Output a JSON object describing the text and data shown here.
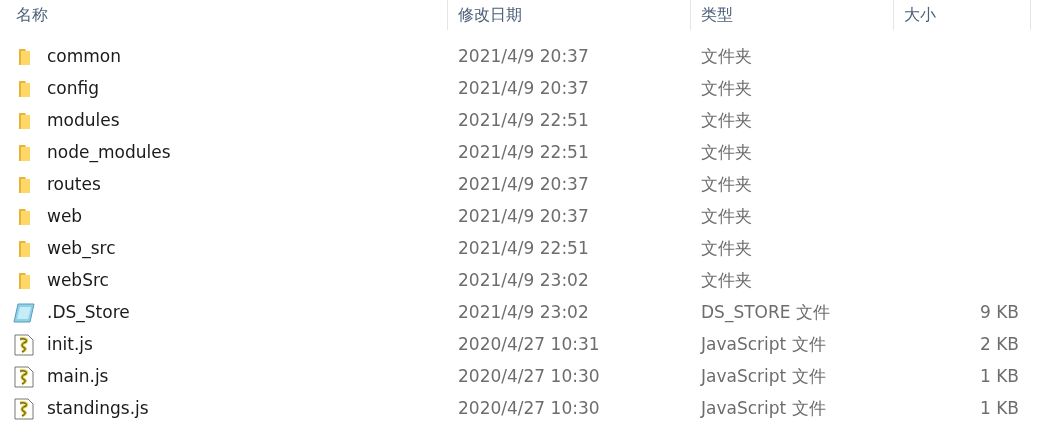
{
  "columns": [
    "名称",
    "修改日期",
    "类型",
    "大小"
  ],
  "files": [
    {
      "kind": "folder",
      "name": "common",
      "date": "2021/4/9 20:37",
      "type": "文件夹"
    },
    {
      "kind": "folder",
      "name": "config",
      "date": "2021/4/9 20:37",
      "type": "文件夹"
    },
    {
      "kind": "folder",
      "name": "modules",
      "date": "2021/4/9 22:51",
      "type": "文件夹"
    },
    {
      "kind": "folder",
      "name": "node_modules",
      "date": "2021/4/9 22:51",
      "type": "文件夹"
    },
    {
      "kind": "folder",
      "name": "routes",
      "date": "2021/4/9 20:37",
      "type": "文件夹"
    },
    {
      "kind": "folder",
      "name": "web",
      "date": "2021/4/9 20:37",
      "type": "文件夹"
    },
    {
      "kind": "folder",
      "name": "web_src",
      "date": "2021/4/9 22:51",
      "type": "文件夹"
    },
    {
      "kind": "folder",
      "name": "webSrc",
      "date": "2021/4/9 23:02",
      "type": "文件夹"
    },
    {
      "kind": "notepad",
      "name": ".DS_Store",
      "date": "2021/4/9 23:02",
      "type": "DS_STORE 文件",
      "size": "9 KB"
    },
    {
      "kind": "script",
      "name": "init.js",
      "date": "2020/4/27 10:31",
      "type": "JavaScript 文件",
      "size": "2 KB"
    },
    {
      "kind": "script",
      "name": "main.js",
      "date": "2020/4/27 10:30",
      "type": "JavaScript 文件",
      "size": "1 KB"
    },
    {
      "kind": "script",
      "name": "standings.js",
      "date": "2020/4/27 10:30",
      "type": "JavaScript 文件",
      "size": "1 KB"
    }
  ]
}
